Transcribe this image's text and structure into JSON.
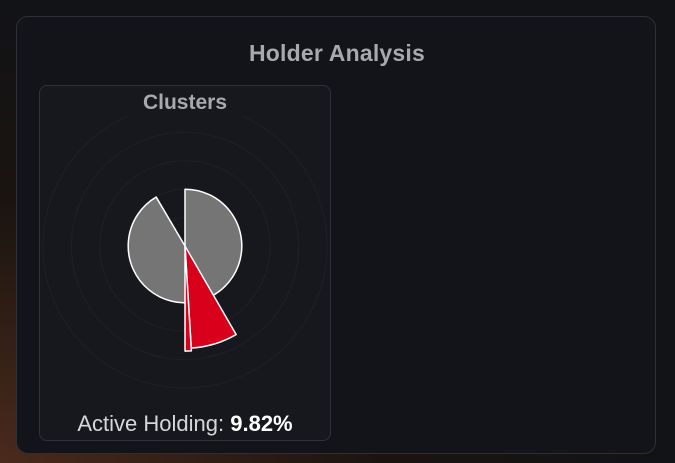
{
  "panel": {
    "title": "Holder Analysis"
  },
  "clusters_card": {
    "title": "Clusters",
    "active_holding_label": "Active Holding:",
    "active_holding_value": "9.82%"
  },
  "colors": {
    "panel_bg": "#131419",
    "card_bg": "#17181d",
    "border": "#30323a",
    "title_text": "#a7a9ae",
    "inactive_slice": "#757575",
    "active_slice": "#d9001b",
    "slice_stroke": "#ffffff",
    "ring": "#1f2026"
  },
  "chart_data": {
    "type": "polar-area",
    "slices": [
      {
        "color": "#757575",
        "radius": 0.4,
        "start_angle_deg": 0,
        "end_angle_deg": 329.5
      },
      {
        "color": "#d9001b",
        "radius": 0.72,
        "start_angle_deg": 150,
        "end_angle_deg": 176.5
      },
      {
        "color": "#d9001b",
        "radius": 0.74,
        "start_angle_deg": 176.5,
        "end_angle_deg": 180
      }
    ],
    "rings": 5
  }
}
